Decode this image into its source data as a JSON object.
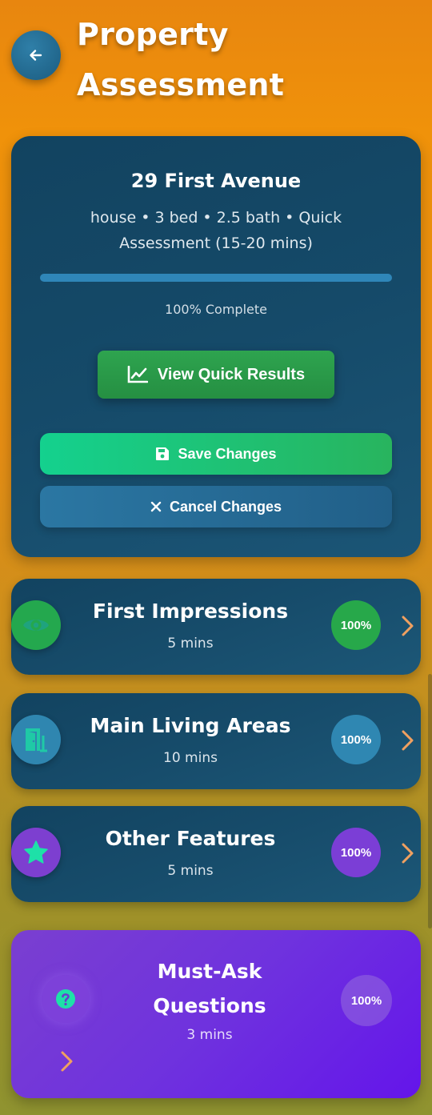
{
  "header": {
    "title": "Property Assessment",
    "back_icon": "arrow-left-icon"
  },
  "property": {
    "address": "29 First Avenue",
    "details": "house • 3 bed • 2.5 bath • Quick Assessment (15-20 mins)",
    "progress_fraction": 1.0,
    "progress_text": "100% Complete"
  },
  "actions": {
    "view_results_label": "View Quick Results",
    "view_results_icon": "chart-line-icon",
    "save_label": "Save Changes",
    "save_icon": "floppy-disk-icon",
    "cancel_label": "Cancel Changes",
    "cancel_icon": "x-icon"
  },
  "sections": [
    {
      "title": "First Impressions",
      "time": "5 mins",
      "percent": "100%",
      "icon": "eye-icon",
      "icon_bg": "#24a84e",
      "icon_color": "#1fa37e",
      "badge_bg": "#27a84a"
    },
    {
      "title": "Main Living Areas",
      "time": "10 mins",
      "percent": "100%",
      "icon": "door-open-icon",
      "icon_bg": "#2f86b0",
      "icon_color": "#1fc9a6",
      "badge_bg": "#2f87b2"
    },
    {
      "title": "Other Features",
      "time": "5 mins",
      "percent": "100%",
      "icon": "star-icon",
      "icon_bg": "#7d3fd0",
      "icon_color": "#1ee0a8",
      "badge_bg": "#7b3ed6"
    }
  ],
  "must_ask": {
    "title": "Must-Ask Questions",
    "time": "3 mins",
    "percent": "100%",
    "icon": "question-circle-icon"
  },
  "colors": {
    "chevron": "#f0a060",
    "accent_green": "#2ea44f",
    "card_dark": "#134561",
    "purple": "#6f32de"
  }
}
